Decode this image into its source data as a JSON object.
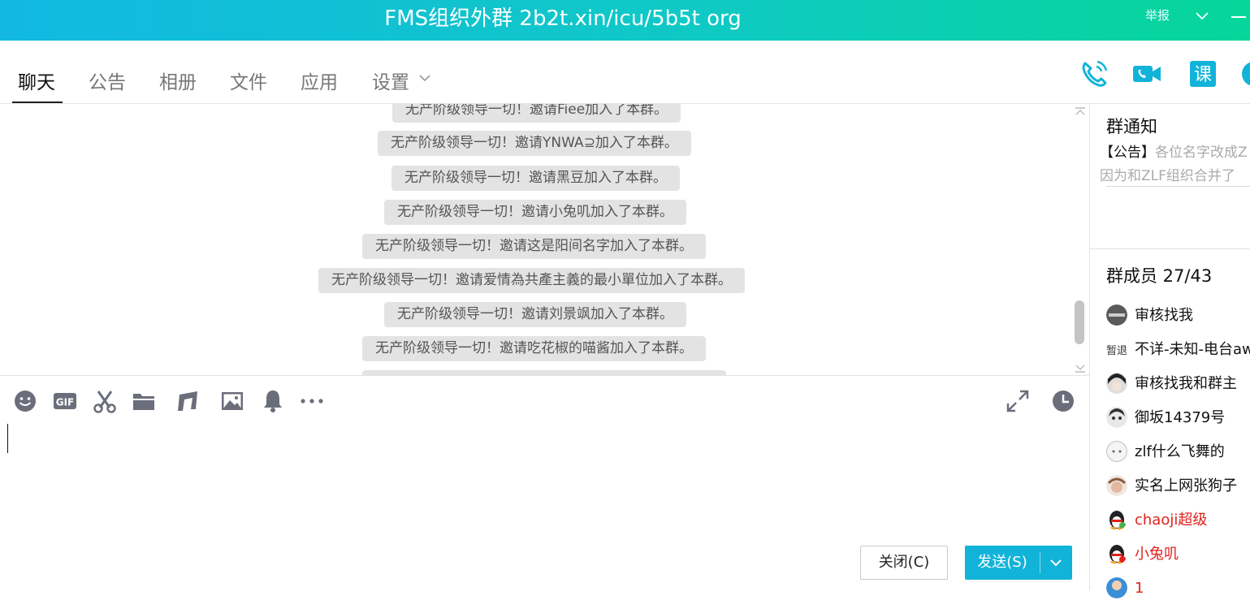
{
  "window": {
    "title": "FMS组织外群 2b2t.xin/icu/5b5t org",
    "report_label": "举报"
  },
  "tabs": [
    "聊天",
    "公告",
    "相册",
    "文件",
    "应用",
    "设置"
  ],
  "messages": [
    "无产阶级领导一切！邀请Fiee加入了本群。",
    "无产阶级领导一切！邀请YNWA⊇加入了本群。",
    "无产阶级领导一切！邀请黑豆加入了本群。",
    "无产阶级领导一切！邀请小兔叽加入了本群。",
    "无产阶级领导一切！邀请这是阳间名字加入了本群。",
    "无产阶级领导一切！邀请爱情為共產主義的最小單位加入了本群。",
    "无产阶级领导一切！邀请刘景飒加入了本群。",
    "无产阶级领导一切！邀请吃花椒的喵酱加入了本群。"
  ],
  "buttons": {
    "close": "关闭(C)",
    "send": "发送(S)"
  },
  "notice": {
    "title": "群通知",
    "tag": "【公告】",
    "line1": "各位名字改成Z",
    "line2": "因为和ZLF组织合并了"
  },
  "members": {
    "title": "群成员 27/43",
    "list": [
      {
        "name": "审核找我",
        "red": false
      },
      {
        "name": "不详-未知-电台aw",
        "red": false,
        "tag": "暂退"
      },
      {
        "name": "审核找我和群主",
        "red": false
      },
      {
        "name": "御坂14379号",
        "red": false
      },
      {
        "name": "zlf什么飞舞的",
        "red": false
      },
      {
        "name": "实名上网张狗子",
        "red": false
      },
      {
        "name": "chaoji超级",
        "red": true
      },
      {
        "name": "小兔叽",
        "red": true
      },
      {
        "name": "1",
        "red": true
      }
    ]
  },
  "colors": {
    "title_gradient_start": "#12b8e2",
    "title_gradient_end": "#06d69a",
    "accent": "#12b3d9",
    "icon_gray": "#6b6e7a",
    "member_red": "#e0211b"
  }
}
